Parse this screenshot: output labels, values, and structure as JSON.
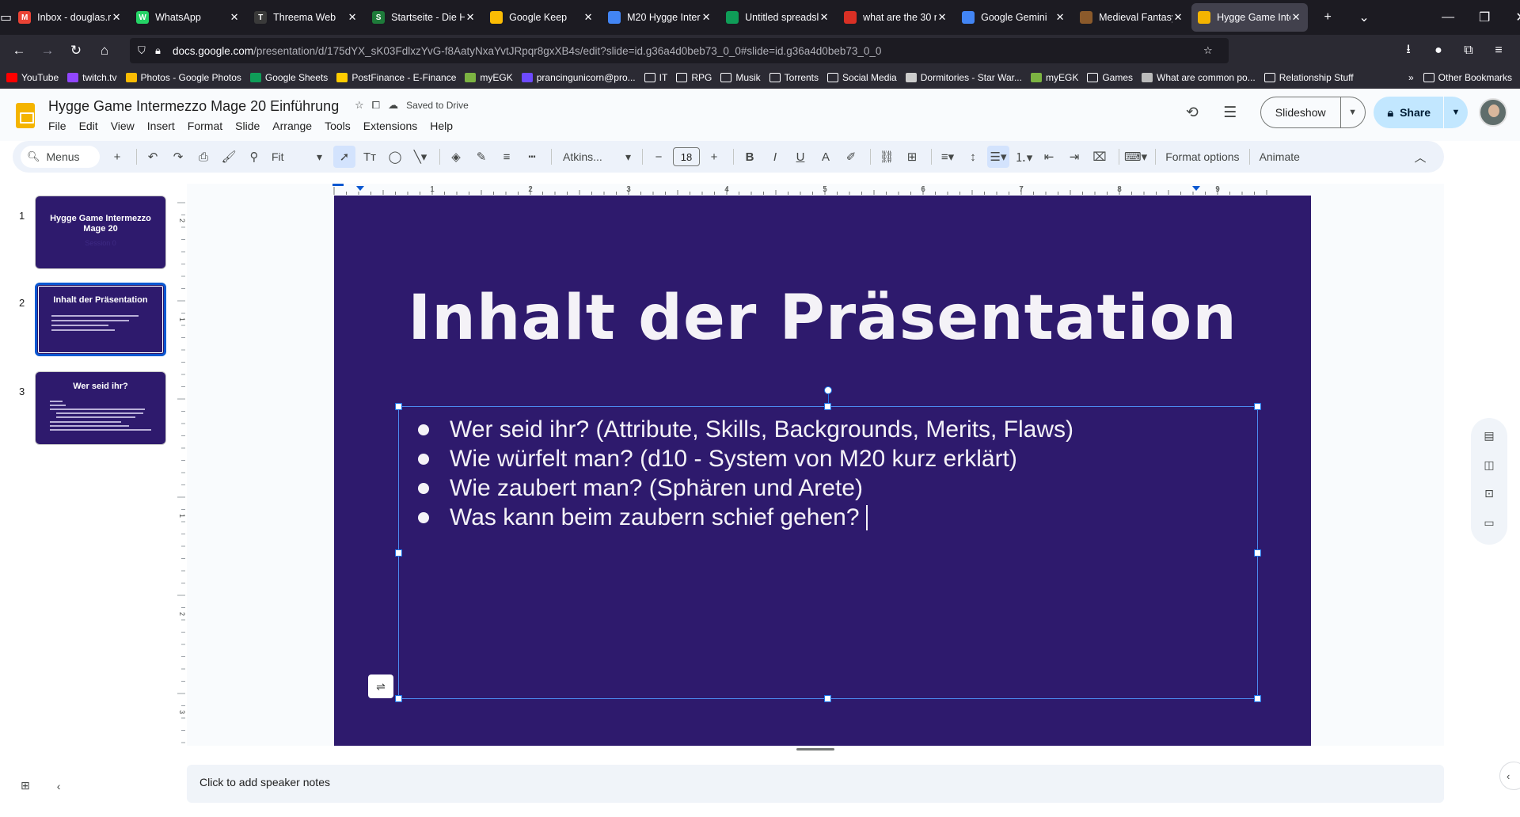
{
  "browser": {
    "tabs": [
      {
        "label": "Inbox - douglas.r",
        "fav_color": "#ea4335",
        "fav_text": "M"
      },
      {
        "label": "WhatsApp",
        "fav_color": "#25d366",
        "fav_text": "W"
      },
      {
        "label": "Threema Web",
        "fav_color": "#3a3a3a",
        "fav_text": "T"
      },
      {
        "label": "Startseite - Die H",
        "fav_color": "#1e7b3a",
        "fav_text": "S"
      },
      {
        "label": "Google Keep",
        "fav_color": "#fbbc04",
        "fav_text": ""
      },
      {
        "label": "M20 Hygge Inter",
        "fav_color": "#4285f4",
        "fav_text": ""
      },
      {
        "label": "Untitled spreadsl",
        "fav_color": "#0f9d58",
        "fav_text": ""
      },
      {
        "label": "what are the 30 r",
        "fav_color": "#d93025",
        "fav_text": ""
      },
      {
        "label": "Google Gemini",
        "fav_color": "#4285f4",
        "fav_text": ""
      },
      {
        "label": "Medieval Fantasy",
        "fav_color": "#8b5a2b",
        "fav_text": ""
      },
      {
        "label": "Hygge Game Inte",
        "fav_color": "#f4b400",
        "fav_text": ""
      }
    ],
    "active_tab_index": 10,
    "url_domain": "docs.google.com",
    "url_path": "/presentation/d/175dYX_sK03FdlxzYvG-f8AatyNxaYvtJRpqr8gxXB4s/edit?slide=id.g36a4d0beb73_0_0#slide=id.g36a4d0beb73_0_0",
    "bookmarks": [
      {
        "label": "YouTube",
        "kind": "site",
        "color": "#ff0000"
      },
      {
        "label": "twitch.tv",
        "kind": "site",
        "color": "#9146ff"
      },
      {
        "label": "Photos - Google Photos",
        "kind": "site",
        "color": "#fbbc04"
      },
      {
        "label": "Google Sheets",
        "kind": "site",
        "color": "#0f9d58"
      },
      {
        "label": "PostFinance - E-Finance",
        "kind": "site",
        "color": "#ffcc00"
      },
      {
        "label": "myEGK",
        "kind": "site",
        "color": "#7cb342"
      },
      {
        "label": "prancingunicorn@pro...",
        "kind": "site",
        "color": "#6d4aff"
      },
      {
        "label": "IT",
        "kind": "folder"
      },
      {
        "label": "RPG",
        "kind": "folder"
      },
      {
        "label": "Musik",
        "kind": "folder"
      },
      {
        "label": "Torrents",
        "kind": "folder"
      },
      {
        "label": "Social Media",
        "kind": "folder"
      },
      {
        "label": "Dormitories - Star War...",
        "kind": "site",
        "color": "#cccccc"
      },
      {
        "label": "myEGK",
        "kind": "site",
        "color": "#7cb342"
      },
      {
        "label": "Games",
        "kind": "folder"
      },
      {
        "label": "What are common po...",
        "kind": "site",
        "color": "#bbbbbb"
      },
      {
        "label": "Relationship Stuff",
        "kind": "folder"
      }
    ],
    "other_bookmarks": "Other Bookmarks"
  },
  "doc": {
    "title": "Hygge Game Intermezzo Mage 20 Einführung",
    "saved_status": "Saved to Drive",
    "menus": [
      "File",
      "Edit",
      "View",
      "Insert",
      "Format",
      "Slide",
      "Arrange",
      "Tools",
      "Extensions",
      "Help"
    ],
    "slideshow_label": "Slideshow",
    "share_label": "Share"
  },
  "toolbar": {
    "search_label": "Menus",
    "zoom": "Fit",
    "font": "Atkins...",
    "font_size": "18",
    "format_options": "Format options",
    "animate": "Animate"
  },
  "ruler": {
    "h_labels": [
      "1",
      "2",
      "3",
      "4",
      "5",
      "6",
      "7",
      "8",
      "9"
    ],
    "v_labels": [
      "2",
      "1",
      "1",
      "2",
      "3"
    ]
  },
  "filmstrip": [
    {
      "num": "1",
      "title": "Hygge Game Intermezzo Mage 20",
      "subtitle": "Session 0"
    },
    {
      "num": "2",
      "title": "Inhalt der Präsentation",
      "subtitle": ""
    },
    {
      "num": "3",
      "title": "Wer seid ihr?",
      "subtitle": ""
    }
  ],
  "slide": {
    "title": "Inhalt der Präsentation",
    "bullets": [
      "Wer seid ihr?  (Attribute, Skills, Backgrounds, Merits, Flaws)",
      "Wie würfelt man? (d10 - System von M20 kurz erklärt)",
      "Wie zaubert man? (Sphären und Arete)",
      "Was kann beim zaubern schief gehen?"
    ],
    "background": "#2e1a6d"
  },
  "notes_placeholder": "Click to add speaker notes"
}
